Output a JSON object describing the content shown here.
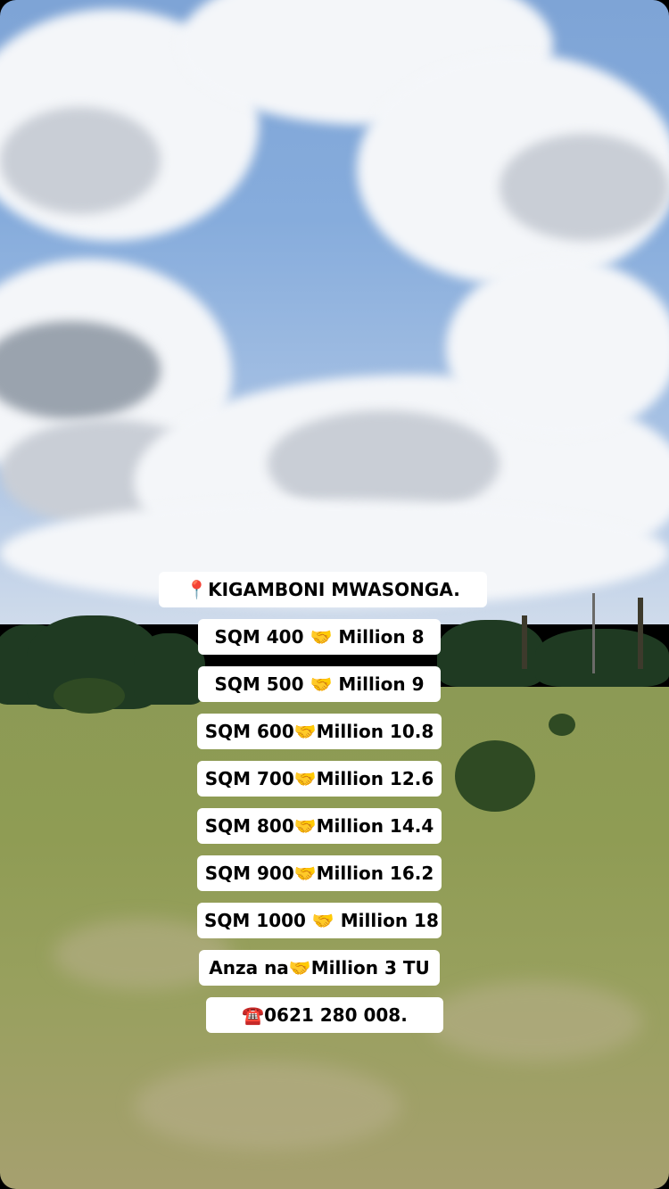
{
  "story": {
    "labels": [
      {
        "icon": "📍",
        "text": "KIGAMBONI MWASONGA."
      },
      {
        "text": "SQM 400 🤝 Million 8"
      },
      {
        "text": "SQM 500 🤝 Million 9"
      },
      {
        "text": "SQM 600🤝Million 10.8"
      },
      {
        "text": "SQM 700🤝Million 12.6"
      },
      {
        "text": "SQM 800🤝Million 14.4"
      },
      {
        "text": "SQM 900🤝Million 16.2"
      },
      {
        "text": "SQM 1000 🤝 Million 18"
      },
      {
        "text": "Anza na🤝Million 3 TU"
      },
      {
        "icon": "☎️",
        "text": "0621 280 008."
      }
    ],
    "icons": [
      "round-pushpin-icon",
      "handshake-icon",
      "telephone-icon"
    ],
    "colors": {
      "label_bg": "#ffffff",
      "label_text": "#000000",
      "sky": "#86acdc",
      "grass": "#8f9c54"
    }
  }
}
